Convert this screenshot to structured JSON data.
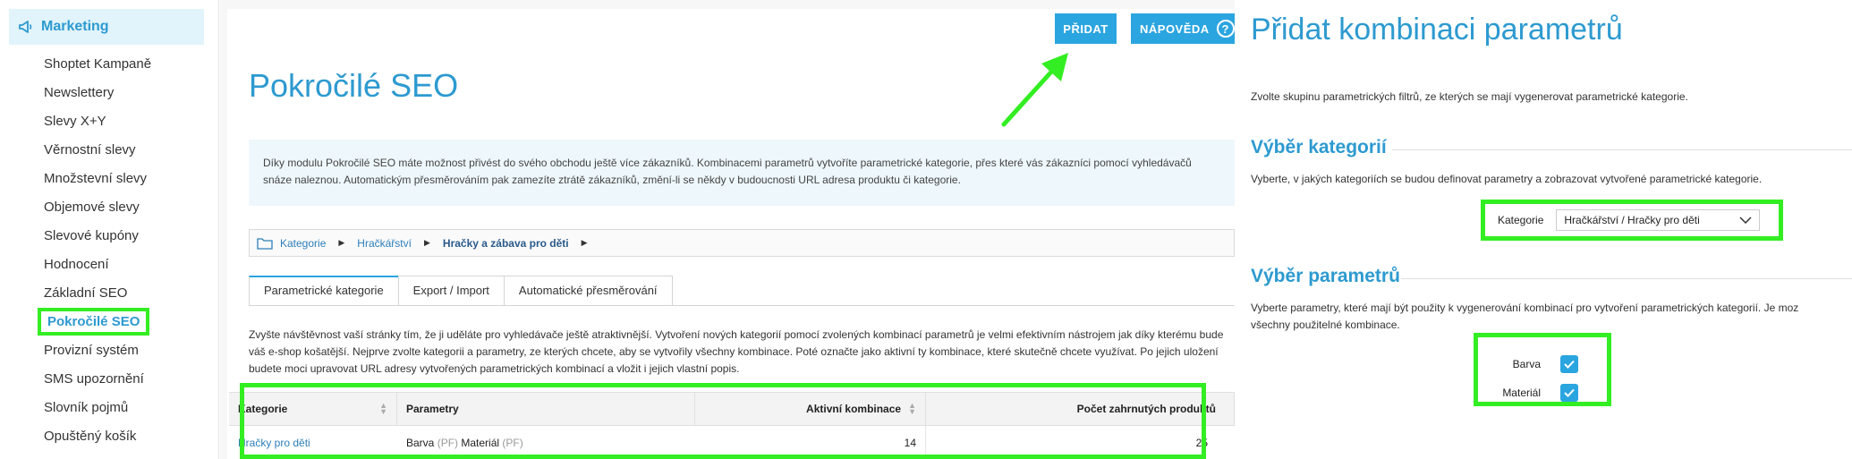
{
  "sidebar": {
    "section_label": "Marketing",
    "items": [
      {
        "label": "Shoptet Kampaně"
      },
      {
        "label": "Newslettery"
      },
      {
        "label": "Slevy X+Y"
      },
      {
        "label": "Věrnostní slevy"
      },
      {
        "label": "Množstevní slevy"
      },
      {
        "label": "Objemové slevy"
      },
      {
        "label": "Slevové kupóny"
      },
      {
        "label": "Hodnocení"
      },
      {
        "label": "Základní SEO"
      },
      {
        "label": "Pokročilé SEO",
        "active": true
      },
      {
        "label": "Provizní systém"
      },
      {
        "label": "SMS upozornění"
      },
      {
        "label": "Slovník pojmů"
      },
      {
        "label": "Opuštěný košík"
      }
    ]
  },
  "header": {
    "add_label": "PŘIDAT",
    "help_label": "NÁPOVĚDA",
    "help_icon": "?"
  },
  "main": {
    "title": "Pokročilé SEO",
    "info_text": "Díky modulu Pokročilé SEO máte možnost přivést do svého obchodu ještě více zákazníků. Kombinacemi parametrů vytvoříte parametrické kategorie, přes které vás zákazníci pomocí vyhledávačů snáze naleznou. Automatickým přesměrováním pak zamezíte ztrátě zákazníků, změní-li se někdy v budoucnosti URL adresa produktu či kategorie.",
    "breadcrumb": {
      "items": [
        "Kategorie",
        "Hračkářství"
      ],
      "current": "Hračky a zábava pro děti",
      "separator": "▶"
    },
    "tabs": [
      "Parametrické kategorie",
      "Export / Import",
      "Automatické přesměrování"
    ],
    "description": "Zvyšte návštěvnost vaší stránky tím, že ji uděláte pro vyhledávače ještě atraktivnější. Vytvoření nových kategorií pomocí zvolených kombinací parametrů je velmi efektivním nástrojem jak díky kterému bude váš e-shop košatější. Nejprve zvolte kategorii a parametry, ze kterých chcete, aby se vytvořily všechny kombinace. Poté označte jako aktivní ty kombinace, které skutečně chcete využívat. Po jejich uložení budete moci upravovat URL adresy vytvořených parametrických kombinací a vložit i jejich vlastní popis.",
    "table": {
      "headers": [
        "Kategorie",
        "Parametry",
        "Aktivní kombinace",
        "Počet zahrnutých produktů"
      ],
      "rows": [
        {
          "category": "Hračky pro děti",
          "param1": "Barva",
          "param1_tag": "(PF)",
          "param2": "Materiál",
          "param2_tag": "(PF)",
          "active": "14",
          "products": "25"
        }
      ]
    }
  },
  "panel": {
    "title": "Přidat kombinaci parametrů",
    "subtitle": "Zvolte skupinu parametrických filtrů, ze kterých se mají vygenerovat parametrické kategorie.",
    "section1": {
      "heading": "Výběr kategorií",
      "text": "Vyberte, v jakých kategoriích se budou definovat parametry a zobrazovat vytvořené parametrické kategorie.",
      "field_label": "Kategorie",
      "field_value": "Hračkářství / Hračky pro děti"
    },
    "section2": {
      "heading": "Výběr parametrů",
      "text_line1": "Vyberte parametry, které mají být použity k vygenerování kombinací pro vytvoření parametrických kategorií. Je moz",
      "text_line2": "všechny použitelné kombinace.",
      "params": [
        "Barva",
        "Materiál"
      ]
    }
  },
  "colors": {
    "accent": "#2ba5e0",
    "heading": "#2d9ad0",
    "highlight": "#33ee22"
  }
}
